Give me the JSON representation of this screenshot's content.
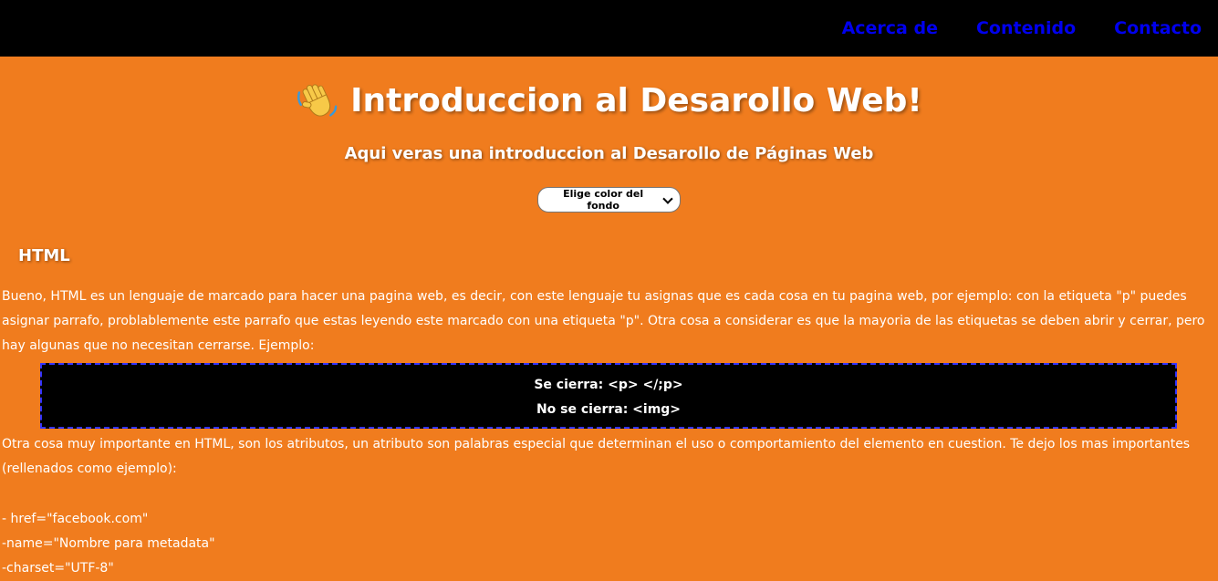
{
  "nav": {
    "items": [
      "Acerca de",
      "Contenido",
      "Contacto"
    ]
  },
  "hero": {
    "icon": "waving-hand-icon",
    "title": "Introduccion al Desarollo Web!",
    "subtitle": "Aqui veras una introduccion al Desarollo de Páginas Web"
  },
  "bg_select": {
    "selected": "Elige color del fondo"
  },
  "section": {
    "heading": "HTML",
    "paragraph1": "Bueno, HTML es un lenguaje de marcado para hacer una pagina web, es decir, con este lenguaje tu asignas que es cada cosa en tu pagina web, por ejemplo: con la etiqueta \"p\" puedes asignar parrafo, problablemente este parrafo que estas leyendo este marcado con una etiqueta \"p\". Otra cosa a considerar es que la mayoria de las etiquetas se deben abrir y cerrar, pero hay algunas que no necesitan cerrarse. Ejemplo:",
    "code_lines": [
      "Se cierra: <p> </;p>",
      "No se cierra: <img>"
    ],
    "paragraph2": "Otra cosa muy importante en HTML, son los atributos, un atributo son palabras especial que determinan el uso o comportamiento del elemento en cuestion. Te dejo los mas importantes (rellenados como ejemplo):",
    "attributes": [
      "- href=\"facebook.com\"",
      "-name=\"Nombre para metadata\"",
      "-charset=\"UTF-8\""
    ]
  },
  "colors": {
    "background": "#f07c1e",
    "topbar": "#000000",
    "nav_link": "#0000ee",
    "code_border": "#3333ff"
  }
}
